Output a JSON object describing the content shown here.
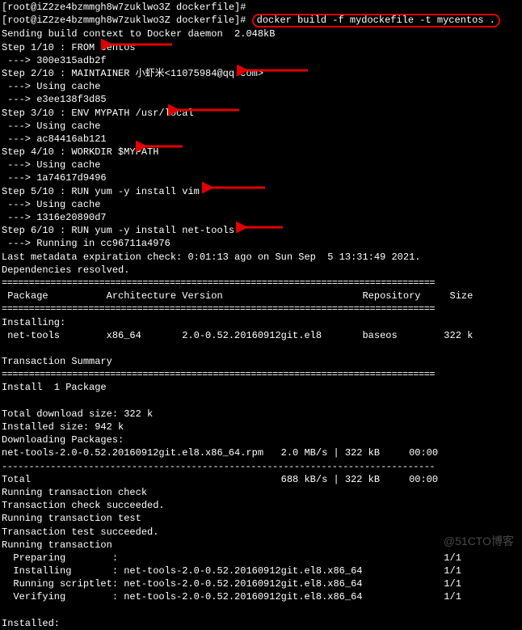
{
  "prompt_host": "[root@iZ2ze4bzmmgh8w7zuklwo3Z dockerfile]#",
  "command": "docker build -f mydockefile -t mycentos .",
  "ctx": "Sending build context to Docker daemon  2.048kB",
  "steps": {
    "s1": "Step 1/10 : FROM centos",
    "s1h": " ---> 300e315adb2f",
    "s2": "Step 2/10 : MAINTAINER 小虾米<11075984@qq.com>",
    "cache": " ---> Using cache",
    "s2h": " ---> e3ee138f3d85",
    "s3": "Step 3/10 : ENV MYPATH /usr/local",
    "s3h": " ---> ac84416ab121",
    "s4": "Step 4/10 : WORKDIR $MYPATH",
    "s4h": " ---> 1a74617d9496",
    "s5": "Step 5/10 : RUN yum -y install vim",
    "s5h": " ---> 1316e20890d7",
    "s6": "Step 6/10 : RUN yum -y install net-tools",
    "s6r": " ---> Running in cc96711a4976"
  },
  "meta": "Last metadata expiration check: 0:01:13 ago on Sun Sep  5 13:31:49 2021.",
  "deps": "Dependencies resolved.",
  "table": {
    "header": " Package          Architecture Version                        Repository     Size",
    "installing": "Installing:",
    "row": " net-tools        x86_64       2.0-0.52.20160912git.el8       baseos        322 k"
  },
  "tsummary": "Transaction Summary",
  "install_pkg": "Install  1 Package",
  "dl_size": "Total download size: 322 k",
  "inst_size": "Installed size: 942 k",
  "dl_pkg": "Downloading Packages:",
  "rpm_line": "net-tools-2.0-0.52.20160912git.el8.x86_64.rpm   2.0 MB/s | 322 kB     00:00",
  "total_line": "Total                                           688 kB/s | 322 kB     00:00",
  "rtc": "Running transaction check",
  "tcs": "Transaction check succeeded.",
  "rtt": "Running transaction test",
  "tts": "Transaction test succeeded.",
  "rt": "Running transaction",
  "prep": "  Preparing        :                                                        1/1",
  "inst": "  Installing       : net-tools-2.0-0.52.20160912git.el8.x86_64              1/1",
  "script": "  Running scriptlet: net-tools-2.0-0.52.20160912git.el8.x86_64              1/1",
  "verify": "  Verifying        : net-tools-2.0-0.52.20160912git.el8.x86_64              1/1",
  "installed": "Installed:",
  "divider_eq": "================================================================================",
  "divider_dash": "--------------------------------------------------------------------------------",
  "watermark": "@51CTO博客"
}
